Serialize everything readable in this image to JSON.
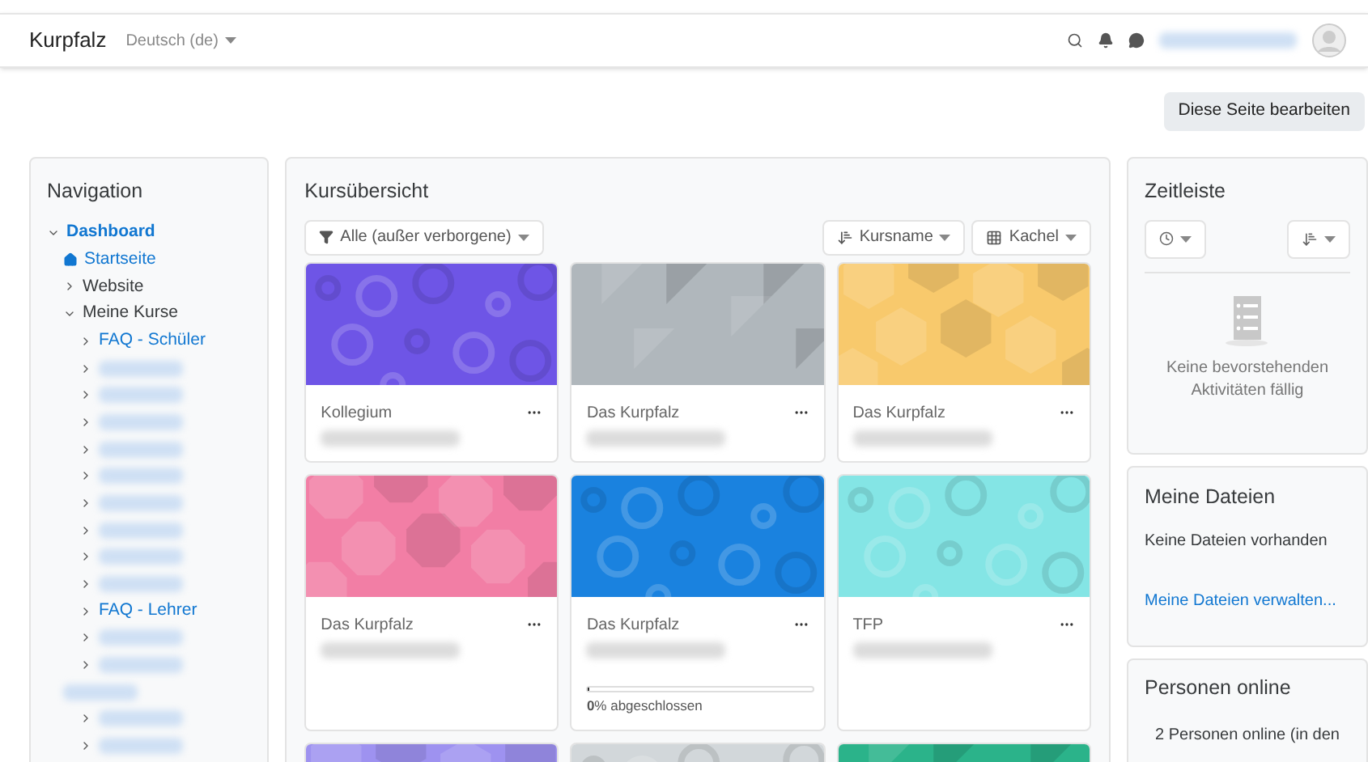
{
  "header": {
    "site_name": "Kurpfalz",
    "language": "Deutsch (de)"
  },
  "edit_button": "Diese Seite bearbeiten",
  "navigation": {
    "title": "Navigation",
    "items": [
      {
        "kind": "link",
        "label": "Dashboard",
        "expanded": true,
        "children": [
          {
            "kind": "home",
            "label": "Startseite"
          },
          {
            "kind": "plain",
            "label": "Website",
            "expanded": false
          },
          {
            "kind": "plain",
            "label": "Meine Kurse",
            "expanded": true,
            "children": [
              {
                "kind": "link",
                "label": "FAQ - Schüler",
                "expanded": false
              },
              {
                "kind": "blurred",
                "expanded": false
              },
              {
                "kind": "blurred",
                "expanded": false
              },
              {
                "kind": "blurred",
                "expanded": false
              },
              {
                "kind": "blurred",
                "expanded": false
              },
              {
                "kind": "blurred",
                "expanded": false
              },
              {
                "kind": "blurred",
                "expanded": false
              },
              {
                "kind": "blurred",
                "expanded": false
              },
              {
                "kind": "blurred",
                "expanded": false
              },
              {
                "kind": "blurred",
                "expanded": false
              },
              {
                "kind": "link",
                "label": "FAQ - Lehrer",
                "expanded": false
              },
              {
                "kind": "blurred",
                "expanded": false
              },
              {
                "kind": "blurred",
                "expanded": false
              }
            ]
          },
          {
            "kind": "plain_blurred",
            "children": [
              {
                "kind": "blurred",
                "expanded": false
              },
              {
                "kind": "blurred",
                "expanded": false
              }
            ]
          }
        ]
      }
    ]
  },
  "course_overview": {
    "title": "Kursübersicht",
    "filter": "Alle (außer verborgene)",
    "sort": "Kursname",
    "view": "Kachel",
    "courses": [
      {
        "kind": "circles",
        "color": "#6e55e6",
        "name": "Kollegium"
      },
      {
        "kind": "triangles",
        "color": "#b0b7bc",
        "name": "Das Kurpfalz"
      },
      {
        "kind": "hexagons",
        "color": "#f8c96c",
        "name": "Das Kurpfalz"
      },
      {
        "kind": "octagons",
        "color": "#f27ea5",
        "name": "Das Kurpfalz"
      },
      {
        "kind": "circles",
        "color": "#1a82df",
        "name": "Das Kurpfalz",
        "progress": {
          "level": 0,
          "label": "**0**% abgeschlossen"
        }
      },
      {
        "kind": "circles",
        "color": "#84e5e5",
        "name": "TFP"
      },
      {
        "kind": "hexagons",
        "color": "#9e92f0"
      },
      {
        "kind": "circles",
        "color": "#d2d7da"
      },
      {
        "kind": "triangles",
        "color": "#2bb38a"
      }
    ]
  },
  "timeline": {
    "title": "Zeitleiste",
    "empty": "Keine bevorstehenden Aktivitäten fällig"
  },
  "files": {
    "title": "Meine Dateien",
    "empty": "Keine Dateien vorhanden",
    "link": "Meine Dateien verwalten..."
  },
  "online": {
    "title": "Personen online",
    "text": "2 Personen online (in den"
  }
}
